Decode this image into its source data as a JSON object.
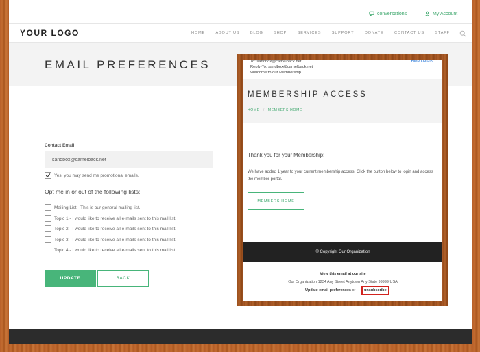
{
  "utility_bar": {
    "conversations_label": "conversations",
    "account_label": "My Account"
  },
  "nav": {
    "logo": "YOUR LOGO",
    "items": [
      "HOME",
      "ABOUT US",
      "BLOG",
      "SHOP",
      "SERVICES",
      "SUPPORT",
      "DONATE",
      "CONTACT US",
      "STAFF"
    ]
  },
  "page": {
    "title": "EMAIL PREFERENCES"
  },
  "form": {
    "email_label": "Contact Email",
    "email_value": "sandbox@camelback.net",
    "promo_label": "Yes, you may send me promotional emails.",
    "promo_checked": true,
    "lists_heading": "Opt me in or out of the following lists:",
    "lists": [
      {
        "label": "Mailing List - This is our general mailing list.",
        "checked": false
      },
      {
        "label": "Topic 1 - I would like to receive all e-mails sent to this mail list.",
        "checked": false
      },
      {
        "label": "Topic 2 - I would like to receive all e-mails sent to this mail list.",
        "checked": false
      },
      {
        "label": "Topic 3 - I would like to receive all e-mails sent to this mail list.",
        "checked": false
      },
      {
        "label": "Topic 4 - I would like to receive all e-mails sent to this mail list.",
        "checked": false
      }
    ],
    "update_label": "UPDATE",
    "back_label": "BACK"
  },
  "email_preview": {
    "to_line": "To:  sandbox@camelback.net",
    "reply_to_line": "Reply-To:  sandbox@camelback.net",
    "subject_line": "Welcome to our Membership",
    "hide_details": "Hide Details",
    "title": "MEMBERSHIP ACCESS",
    "breadcrumb_home": "HOME",
    "breadcrumb_sep": "/",
    "breadcrumb_current": "MEMBERS HOME",
    "thanks": "Thank you for your Membership!",
    "body": "We have added 1 year to your current membership access. Click the button below to login and access the member portal.",
    "button_label": "MEMBERS HOME",
    "copyright": "© Copyright Our Organization",
    "view_site": "View this email at our site",
    "address": "Our Organization 1234 Any Street Anytown Any State 99999 USA",
    "update_prefs": "Update email preferences",
    "or_text": "or",
    "unsubscribe": "unsubscribe"
  },
  "colors": {
    "accent_green": "#48b57a",
    "highlight_red": "#d1231e",
    "link_blue": "#1a6fd6"
  }
}
